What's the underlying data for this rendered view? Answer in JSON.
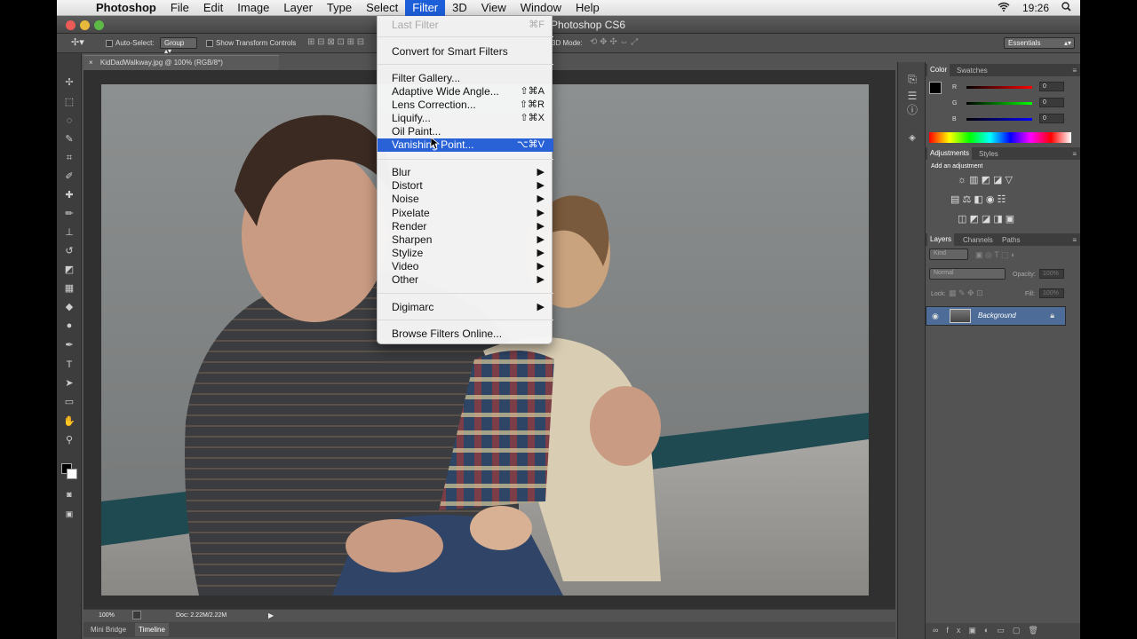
{
  "menubar": {
    "app": "Photoshop",
    "items": [
      "File",
      "Edit",
      "Image",
      "Layer",
      "Type",
      "Select",
      "Filter",
      "3D",
      "View",
      "Window",
      "Help"
    ],
    "clock": "19:26"
  },
  "window": {
    "title": "Photoshop CS6"
  },
  "options": {
    "auto_select": "Auto-Select:",
    "group": "Group",
    "show_transform": "Show Transform Controls",
    "mode_3d": "3D Mode:",
    "workspace": "Essentials"
  },
  "document": {
    "tab": "KidDadWalkway.jpg @ 100% (RGB/8*)",
    "zoom": "100%",
    "doc_size": "Doc: 2.22M/2.22M"
  },
  "bottom_tabs": [
    "Mini Bridge",
    "Timeline"
  ],
  "color_panel": {
    "tabs": [
      "Color",
      "Swatches"
    ],
    "r_label": "R",
    "g_label": "G",
    "b_label": "B",
    "r": "0",
    "g": "0",
    "b": "0"
  },
  "adjustments_panel": {
    "tabs": [
      "Adjustments",
      "Styles"
    ],
    "add": "Add an adjustment"
  },
  "layers_panel": {
    "tabs": [
      "Layers",
      "Channels",
      "Paths"
    ],
    "kind": "Kind",
    "blend": "Normal",
    "opacity_label": "Opacity:",
    "opacity": "100%",
    "lock_label": "Lock:",
    "fill_label": "Fill:",
    "fill": "100%",
    "layer_name": "Background"
  },
  "filter_menu": {
    "last_filter": "Last Filter",
    "last_filter_sc": "⌘F",
    "convert": "Convert for Smart Filters",
    "gallery": "Filter Gallery...",
    "adaptive": "Adaptive Wide Angle...",
    "adaptive_sc": "⇧⌘A",
    "lens": "Lens Correction...",
    "lens_sc": "⇧⌘R",
    "liquify": "Liquify...",
    "liquify_sc": "⇧⌘X",
    "oil": "Oil Paint...",
    "vanishing": "Vanishing Point...",
    "vanishing_sc": "⌥⌘V",
    "submenus": [
      "Blur",
      "Distort",
      "Noise",
      "Pixelate",
      "Render",
      "Sharpen",
      "Stylize",
      "Video",
      "Other"
    ],
    "digimarc": "Digimarc",
    "browse": "Browse Filters Online..."
  },
  "colors": {
    "highlight": "#2961d6",
    "chrome": "#535353",
    "panel_dark": "#3d3d3d"
  }
}
